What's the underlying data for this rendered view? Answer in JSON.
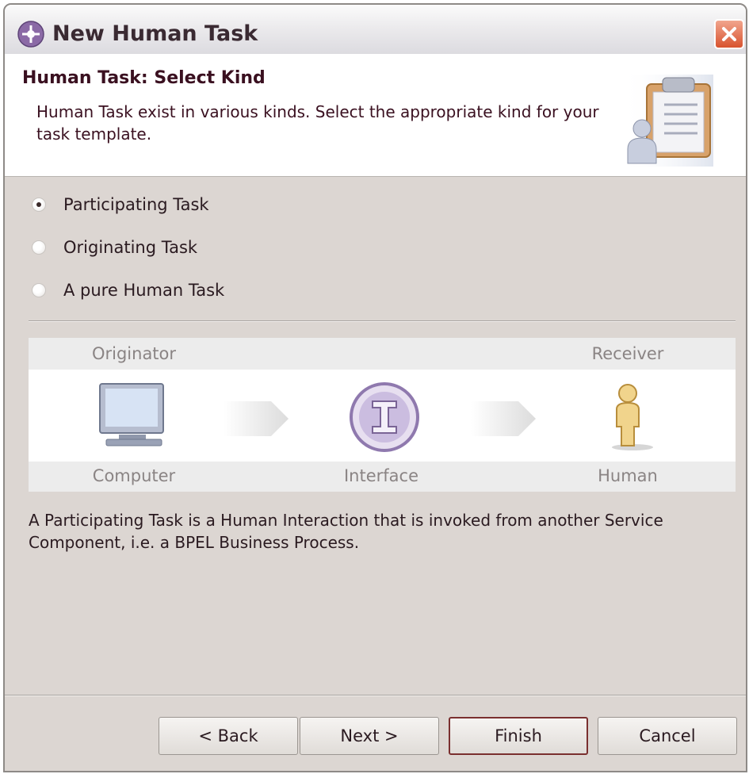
{
  "window": {
    "title": "New Human Task"
  },
  "banner": {
    "title": "Human Task: Select Kind",
    "description": "Human Task exist in various kinds. Select the appropriate kind for your task template."
  },
  "options": [
    {
      "label": "Participating Task",
      "selected": true
    },
    {
      "label": "Originating Task",
      "selected": false
    },
    {
      "label": "A pure Human Task",
      "selected": false
    }
  ],
  "diagram": {
    "originator_label": "Originator",
    "receiver_label": "Receiver",
    "nodes": [
      {
        "label": "Computer",
        "icon": "computer-icon"
      },
      {
        "label": "Interface",
        "icon": "interface-icon"
      },
      {
        "label": "Human",
        "icon": "human-icon"
      }
    ]
  },
  "description": "A Participating Task is a Human Interaction that is invoked from another Service Component, i.e. a BPEL Business Process.",
  "buttons": {
    "back": "< Back",
    "next": "Next >",
    "finish": "Finish",
    "cancel": "Cancel"
  },
  "colors": {
    "dialog_bg": "#dcd6d2",
    "banner_bg": "#ffffff",
    "text": "#2a1a20",
    "diagram_label": "#8a8484",
    "close_button": "#d8532f"
  }
}
